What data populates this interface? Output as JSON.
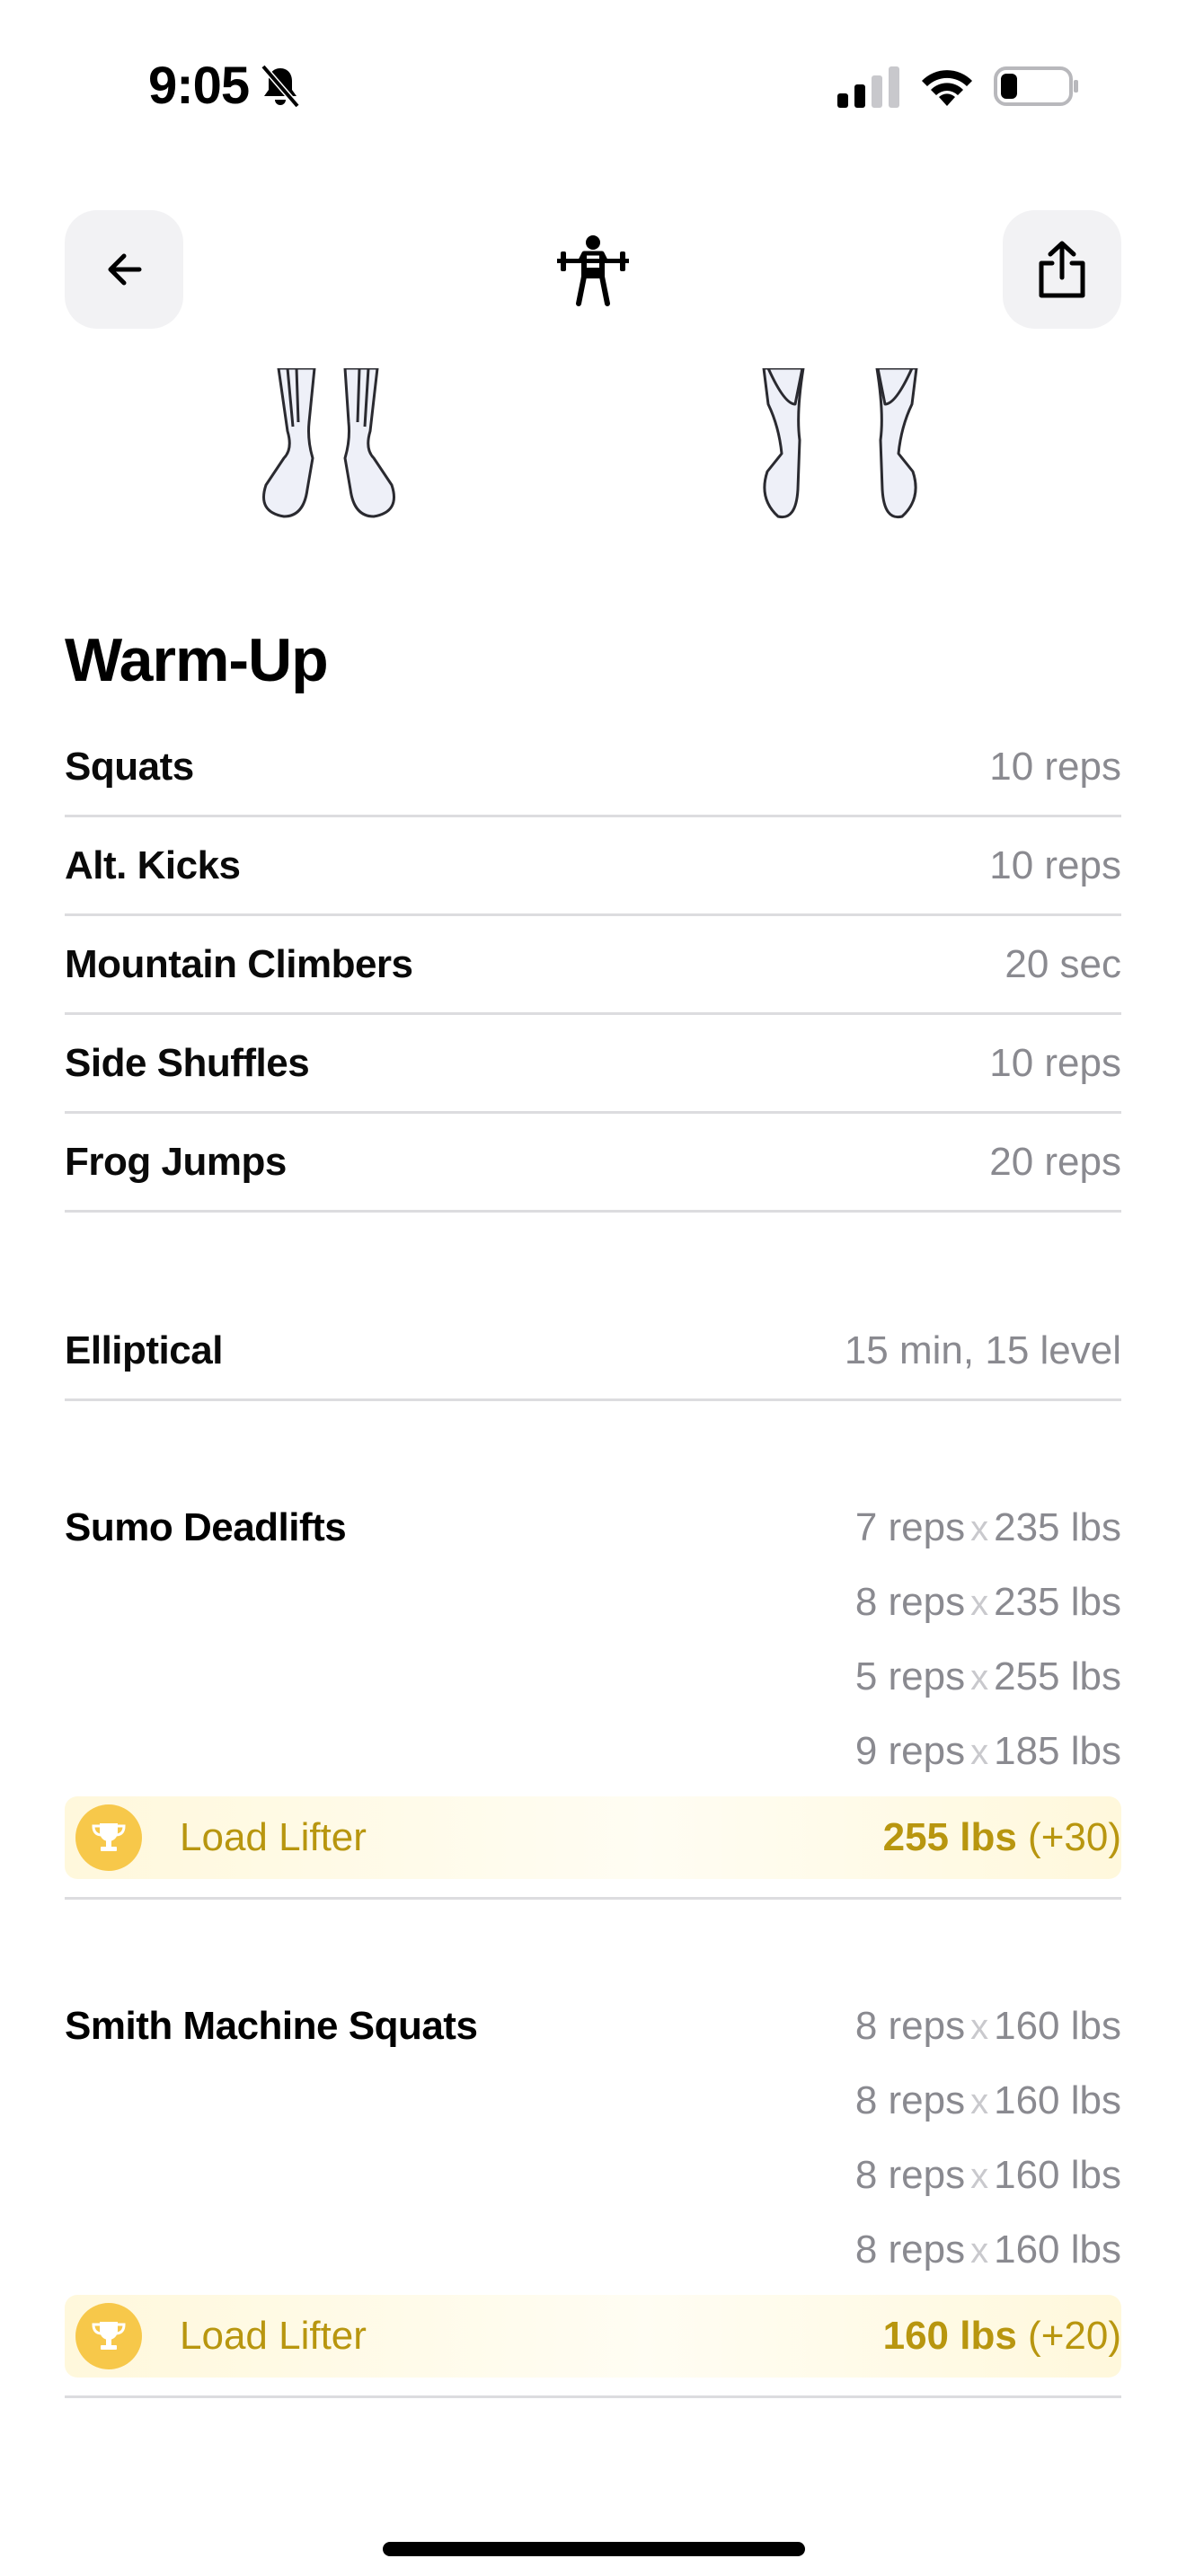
{
  "status_bar": {
    "time": "9:05"
  },
  "warmup": {
    "title": "Warm-Up",
    "items": [
      {
        "name": "Squats",
        "value": "10 reps"
      },
      {
        "name": "Alt. Kicks",
        "value": "10 reps"
      },
      {
        "name": "Mountain Climbers",
        "value": "20 sec"
      },
      {
        "name": "Side Shuffles",
        "value": "10 reps"
      },
      {
        "name": "Frog Jumps",
        "value": "20 reps"
      }
    ]
  },
  "cardio": {
    "name": "Elliptical",
    "value": "15 min, 15 level"
  },
  "exercises": [
    {
      "name": "Sumo Deadlifts",
      "sets": [
        {
          "reps": "7 reps",
          "x": "x",
          "weight": "235 lbs"
        },
        {
          "reps": "8 reps",
          "x": "x",
          "weight": "235 lbs"
        },
        {
          "reps": "5 reps",
          "x": "x",
          "weight": "255 lbs"
        },
        {
          "reps": "9 reps",
          "x": "x",
          "weight": "185 lbs"
        }
      ],
      "award": {
        "label": "Load Lifter",
        "weight": "255 lbs",
        "delta": "(+30)"
      }
    },
    {
      "name": "Smith Machine Squats",
      "sets": [
        {
          "reps": "8 reps",
          "x": "x",
          "weight": "160 lbs"
        },
        {
          "reps": "8 reps",
          "x": "x",
          "weight": "160 lbs"
        },
        {
          "reps": "8 reps",
          "x": "x",
          "weight": "160 lbs"
        },
        {
          "reps": "8 reps",
          "x": "x",
          "weight": "160 lbs"
        }
      ],
      "award": {
        "label": "Load Lifter",
        "weight": "160 lbs",
        "delta": "(+20)"
      }
    }
  ],
  "colors": {
    "award_text": "#b8960f",
    "trophy": "#f7c84a",
    "muted": "#8a8a90"
  }
}
